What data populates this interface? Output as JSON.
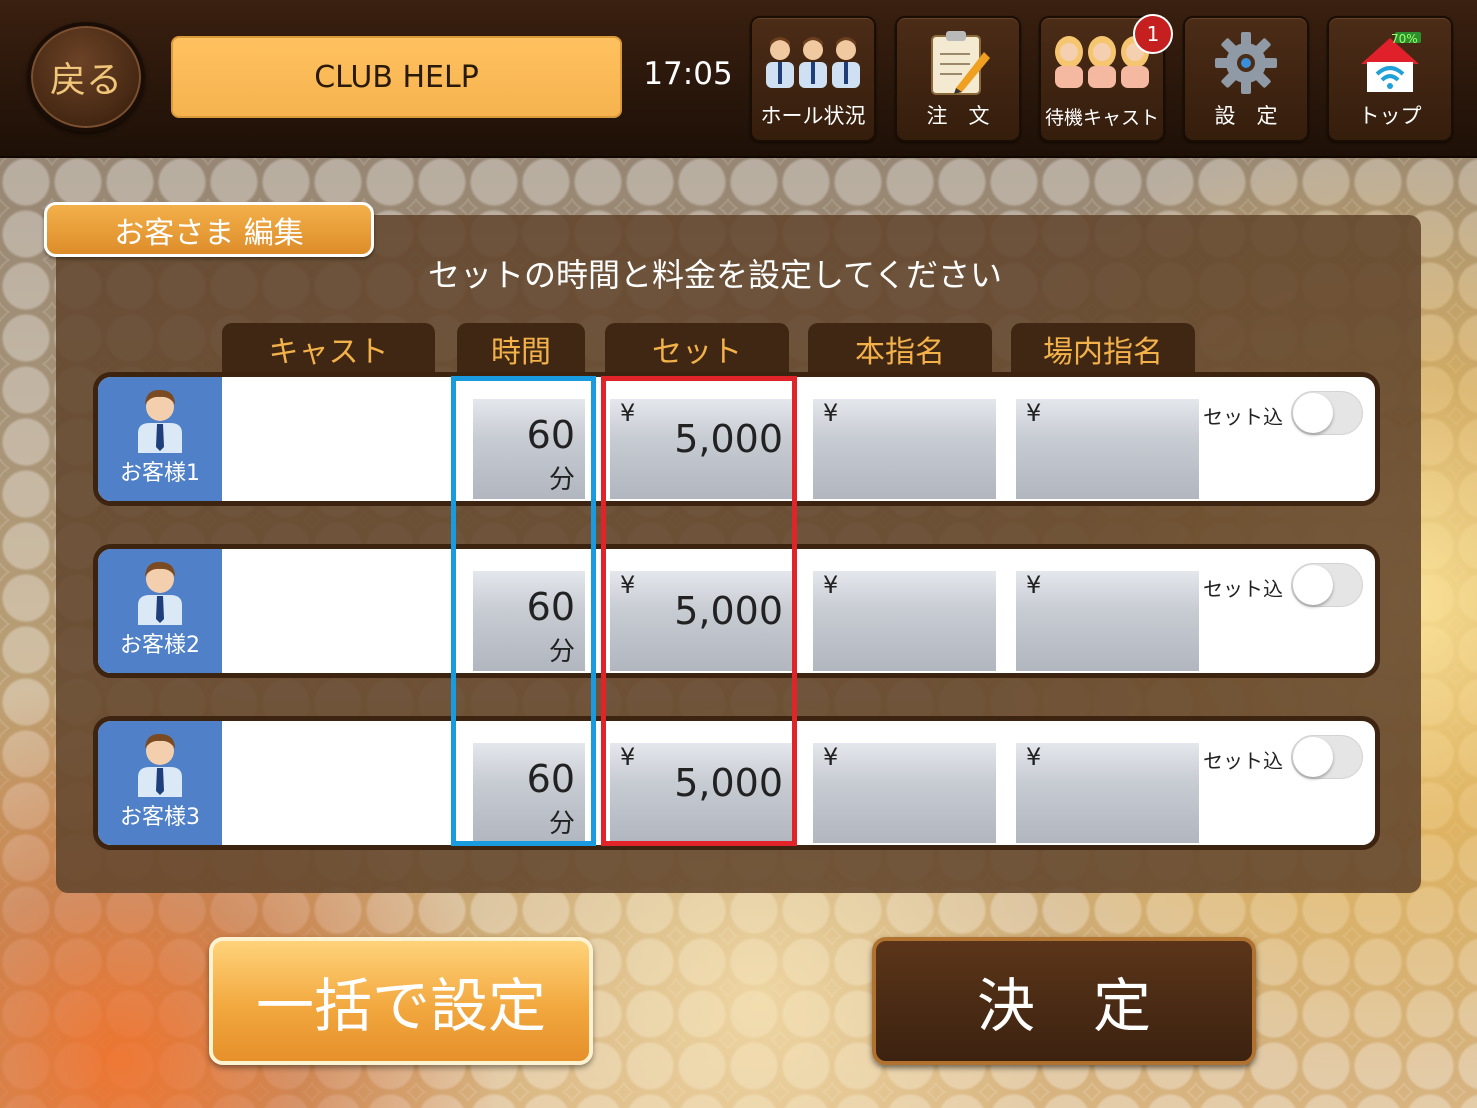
{
  "header": {
    "back_label": "戻る",
    "club_name": "CLUB HELP",
    "time": "17:05",
    "nav": [
      {
        "label": "ホール状況",
        "icon": "people-group-icon"
      },
      {
        "label": "注　文",
        "icon": "clipboard-pencil-icon"
      },
      {
        "label": "待機キャスト",
        "icon": "women-group-icon",
        "badge": "1"
      },
      {
        "label": "設　定",
        "icon": "gear-icon"
      },
      {
        "label": "トップ",
        "icon": "home-wifi-icon",
        "battery_text": "70%"
      }
    ]
  },
  "panel": {
    "tab_label": "お客さま 編集",
    "instruction": "セットの時間と料金を設定してください",
    "columns": [
      "キャスト",
      "時間",
      "セット",
      "本指名",
      "場内指名"
    ],
    "currency": "¥",
    "toggle_label": "セット込",
    "rows": [
      {
        "customer": "お客様1",
        "cast": "",
        "time": "60",
        "time_unit": "分",
        "set": "5,000",
        "honshimei": "",
        "jonaishimei": "",
        "set_included": false
      },
      {
        "customer": "お客様2",
        "cast": "",
        "time": "60",
        "time_unit": "分",
        "set": "5,000",
        "honshimei": "",
        "jonaishimei": "",
        "set_included": false
      },
      {
        "customer": "お客様3",
        "cast": "",
        "time": "60",
        "time_unit": "分",
        "set": "5,000",
        "honshimei": "",
        "jonaishimei": "",
        "set_included": false
      }
    ]
  },
  "buttons": {
    "bulk_set": "一括で設定",
    "confirm": "決　定"
  },
  "colors": {
    "time_highlight": "#1a9be0",
    "set_highlight": "#e0242a",
    "accent": "#f3b14a",
    "avatar_bg": "#4f80c8"
  }
}
